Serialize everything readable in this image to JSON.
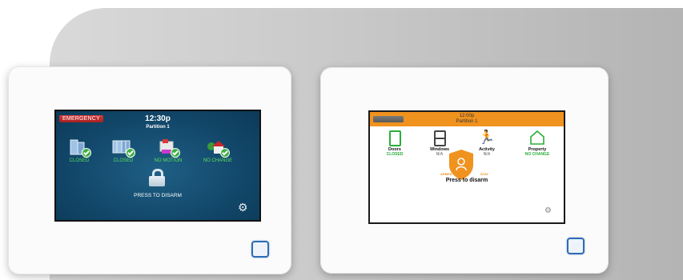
{
  "left_panel": {
    "emergency_label": "EMERGENCY",
    "time": "12:30p",
    "partition": "Partition 1",
    "tiles": [
      {
        "icon": "doors-icon",
        "status": "CLOSED"
      },
      {
        "icon": "windows-icon",
        "status": "CLOSED"
      },
      {
        "icon": "motion-icon",
        "status": "NO MOTION"
      },
      {
        "icon": "property-icon",
        "status": "NO CHANGE"
      }
    ],
    "disarm_label": "PRESS TO DISARM",
    "settings_icon": "gear-icon",
    "colors": {
      "screen": "#12476a",
      "status": "#5be05b",
      "emergency": "#c62828"
    }
  },
  "right_panel": {
    "time": "12:00p",
    "partition": "Partition 1",
    "tiles": [
      {
        "title": "Doors",
        "status": "CLOSED",
        "icon": "door-icon"
      },
      {
        "title": "Windows",
        "status": "N/A",
        "icon": "window-icon"
      },
      {
        "title": "Activity",
        "status": "N/A",
        "icon": "activity-icon"
      },
      {
        "title": "Property",
        "status": "NO CHANGE",
        "icon": "house-icon"
      }
    ],
    "armed_label": "ARMED",
    "stay_label": "STAY",
    "disarm_label": "Press to disarm",
    "settings_icon": "gear-icon",
    "colors": {
      "topbar": "#f0921e",
      "status_ok": "#2bae3a",
      "shield": "#f0921e"
    }
  }
}
